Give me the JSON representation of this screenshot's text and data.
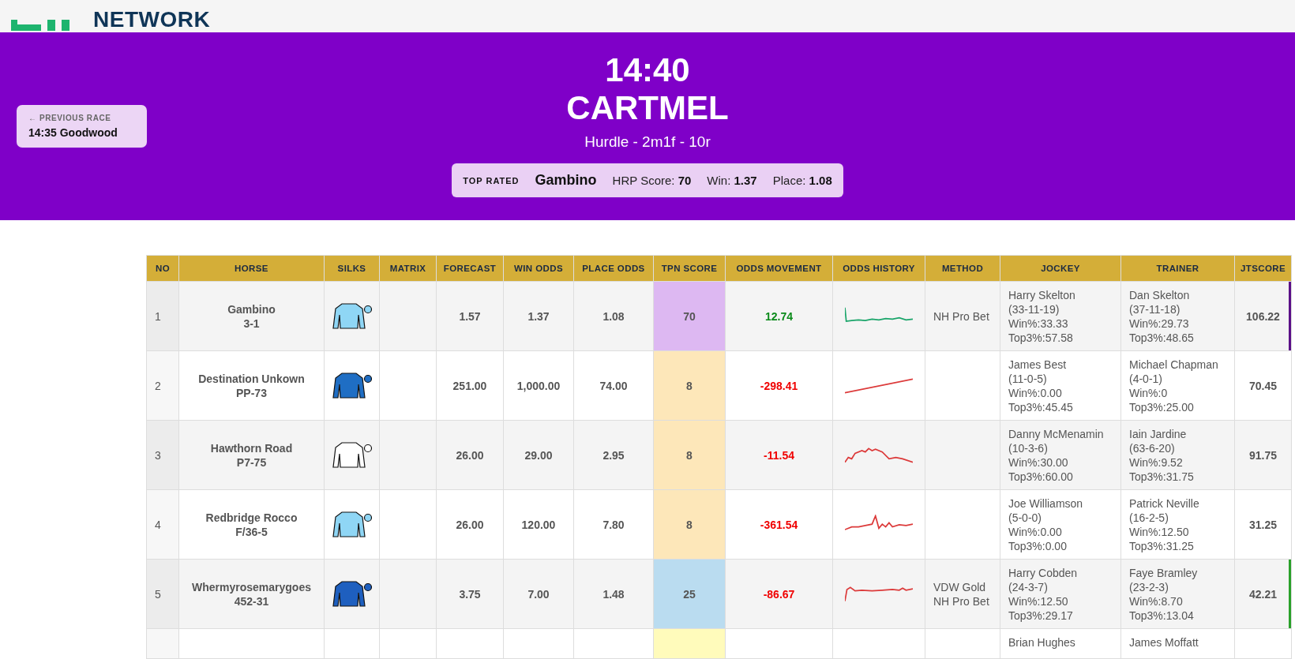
{
  "brand": {
    "name": "NETWORK"
  },
  "previous_race": {
    "label": "← PREVIOUS RACE",
    "race": "14:35 Goodwood"
  },
  "race": {
    "time": "14:40",
    "course": "CARTMEL",
    "details": "Hurdle - 2m1f - 10r"
  },
  "top_rated": {
    "label": "TOP RATED",
    "horse": "Gambino",
    "items": [
      {
        "label": "HRP Score:",
        "value": "70"
      },
      {
        "label": "Win:",
        "value": "1.37"
      },
      {
        "label": "Place:",
        "value": "1.08"
      }
    ]
  },
  "table": {
    "columns": [
      "NO",
      "HORSE",
      "SILKS",
      "MATRIX",
      "FORECAST",
      "WIN ODDS",
      "PLACE ODDS",
      "TPN SCORE",
      "ODDS MOVEMENT",
      "ODDS HISTORY",
      "METHOD",
      "JOCKEY",
      "TRAINER",
      "JTSCORE"
    ],
    "rows": [
      {
        "no": "1",
        "horse": "Gambino",
        "code": "3-1",
        "silks": {
          "color": "#8fd6f5"
        },
        "forecast": "1.57",
        "win_odds": "1.37",
        "place_odds": "1.08",
        "tpn": {
          "score": "70",
          "color": "#ddb8f2"
        },
        "movement": "12.74",
        "kind": "rising",
        "method": [
          "NH Pro Bet"
        ],
        "jockey": [
          "Harry Skelton",
          "(33-11-19)",
          "Win%:33.33",
          "Top3%:57.58"
        ],
        "trainer": [
          "Dan Skelton",
          "(37-11-18)",
          "Win%:29.73",
          "Top3%:48.65"
        ],
        "jtscore": "106.22",
        "edge": {
          "color": "#5b1088"
        }
      },
      {
        "no": "2",
        "horse": "Destination Unkown",
        "code": "PP-73",
        "silks": {
          "color": "#1f6ec4"
        },
        "forecast": "251.00",
        "win_odds": "1,000.00",
        "place_odds": "74.00",
        "tpn": {
          "score": "8",
          "color": "#fde7b9"
        },
        "movement": "-298.41",
        "kind": "falling",
        "method": [],
        "jockey": [
          "James Best",
          "(11-0-5)",
          "Win%:0.00",
          "Top3%:45.45"
        ],
        "trainer": [
          "Michael Chapman",
          "(4-0-1)",
          "Win%:0",
          "Top3%:25.00"
        ],
        "jtscore": "70.45"
      },
      {
        "no": "3",
        "horse": "Hawthorn Road",
        "code": "P7-75",
        "silks": {
          "color": "#ffffff"
        },
        "forecast": "26.00",
        "win_odds": "29.00",
        "place_odds": "2.95",
        "tpn": {
          "score": "8",
          "color": "#fde7b9"
        },
        "movement": "-11.54",
        "kind": "falling",
        "method": [],
        "jockey": [
          "Danny McMenamin",
          "(10-3-6)",
          "Win%:30.00",
          "Top3%:60.00"
        ],
        "trainer": [
          "Iain Jardine",
          "(63-6-20)",
          "Win%:9.52",
          "Top3%:31.75"
        ],
        "jtscore": "91.75"
      },
      {
        "no": "4",
        "horse": "Redbridge Rocco",
        "code": "F/36-5",
        "silks": {
          "color": "#8fd6f5"
        },
        "forecast": "26.00",
        "win_odds": "120.00",
        "place_odds": "7.80",
        "tpn": {
          "score": "8",
          "color": "#fde7b9"
        },
        "movement": "-361.54",
        "kind": "falling",
        "method": [],
        "jockey": [
          "Joe Williamson",
          "(5-0-0)",
          "Win%:0.00",
          "Top3%:0.00"
        ],
        "trainer": [
          "Patrick Neville",
          "(16-2-5)",
          "Win%:12.50",
          "Top3%:31.25"
        ],
        "jtscore": "31.25"
      },
      {
        "no": "5",
        "horse": "Whermyrosemarygoes",
        "code": "452-31",
        "silks": {
          "color": "#1e5fbf"
        },
        "forecast": "3.75",
        "win_odds": "7.00",
        "place_odds": "1.48",
        "tpn": {
          "score": "25",
          "color": "#badcf0"
        },
        "movement": "-86.67",
        "kind": "falling",
        "method": [
          "VDW Gold",
          "NH Pro Bet"
        ],
        "jockey": [
          "Harry Cobden",
          "(24-3-7)",
          "Win%:12.50",
          "Top3%:29.17"
        ],
        "trainer": [
          "Faye Bramley",
          "(23-2-3)",
          "Win%:8.70",
          "Top3%:13.04"
        ],
        "jtscore": "42.21",
        "edge": {
          "color": "#2aa02a"
        }
      },
      {
        "tpn": {
          "color": "#fffbbb"
        },
        "jockey": [
          "Brian Hughes"
        ],
        "trainer": [
          "James Moffatt"
        ]
      }
    ]
  }
}
